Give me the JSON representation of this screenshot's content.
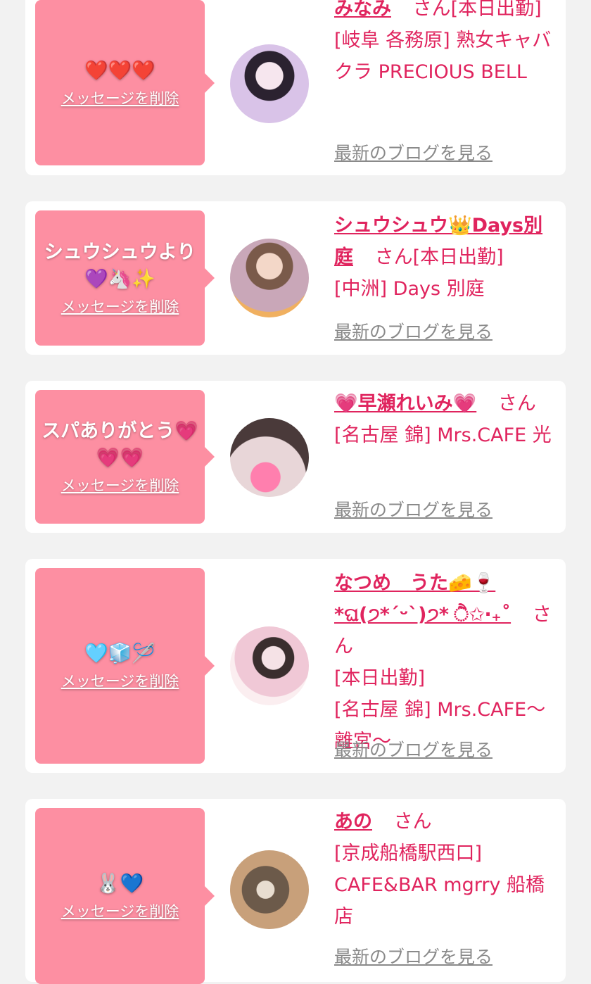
{
  "colors": {
    "background": "#f2f2f2",
    "card": "#ffffff",
    "bubble": "#fd8fa2",
    "accent": "#e0245e",
    "link_gray": "#8a8a8a"
  },
  "delete_label": "メッセージを削除",
  "blog_label": "最新のブログを見る",
  "cards": [
    {
      "message": "❤️❤️❤️",
      "name": "みなみ",
      "san": "さん[本日出勤]",
      "shop": "[岐阜 各務原] 熟女キャバクラ PRECIOUS BELL",
      "avatar_tone": "lavender"
    },
    {
      "message": "シュウシュウより💜🦄✨",
      "name": "シュウシュウ👑Days別庭",
      "san": "さん[本日出勤]",
      "shop": "[中洲] Days 別庭",
      "avatar_tone": "sunset"
    },
    {
      "message": "スパありがとう💗💗💗",
      "name": "💗早瀬れいみ💗",
      "san": "さん",
      "shop": "[名古屋 錦] Mrs.CAFE 光",
      "avatar_tone": "pink-heart"
    },
    {
      "message": "🩵🧊🪡",
      "name": "なつめ　うた🧀🍷*ଘ(੭*ˊᵕˋ)੭* ੈ✩‧₊˚",
      "san": "さん",
      "status": "[本日出勤]",
      "shop": "[名古屋 錦] Mrs.CAFE〜離宮〜",
      "avatar_tone": "floral"
    },
    {
      "message": "🐰💙",
      "name": "あの",
      "san": "さん",
      "shop": "[京成船橋駅西口] CAFE&BAR mgrry 船橋店",
      "avatar_tone": "cafe"
    }
  ]
}
